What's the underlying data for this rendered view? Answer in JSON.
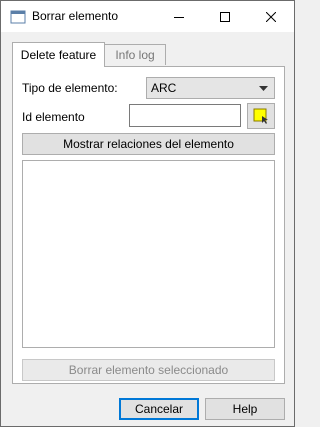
{
  "window": {
    "title": "Borrar elemento",
    "icons": {
      "app": "app-icon",
      "minimize": "minimize-icon",
      "maximize": "maximize-icon",
      "close": "close-icon"
    }
  },
  "tabs": [
    {
      "label": "Delete feature",
      "active": true
    },
    {
      "label": "Info log",
      "active": false
    }
  ],
  "form": {
    "type_label": "Tipo de elemento:",
    "type_value": "ARC",
    "id_label": "Id elemento",
    "id_value": "",
    "pick_icon": "select-feature-icon"
  },
  "buttons": {
    "show_relations": "Mostrar relaciones del elemento",
    "delete_selected": "Borrar elemento seleccionado",
    "cancel": "Cancelar",
    "help": "Help"
  },
  "colors": {
    "accent": "#0078d7",
    "pick_icon_fill": "#ffff00"
  }
}
